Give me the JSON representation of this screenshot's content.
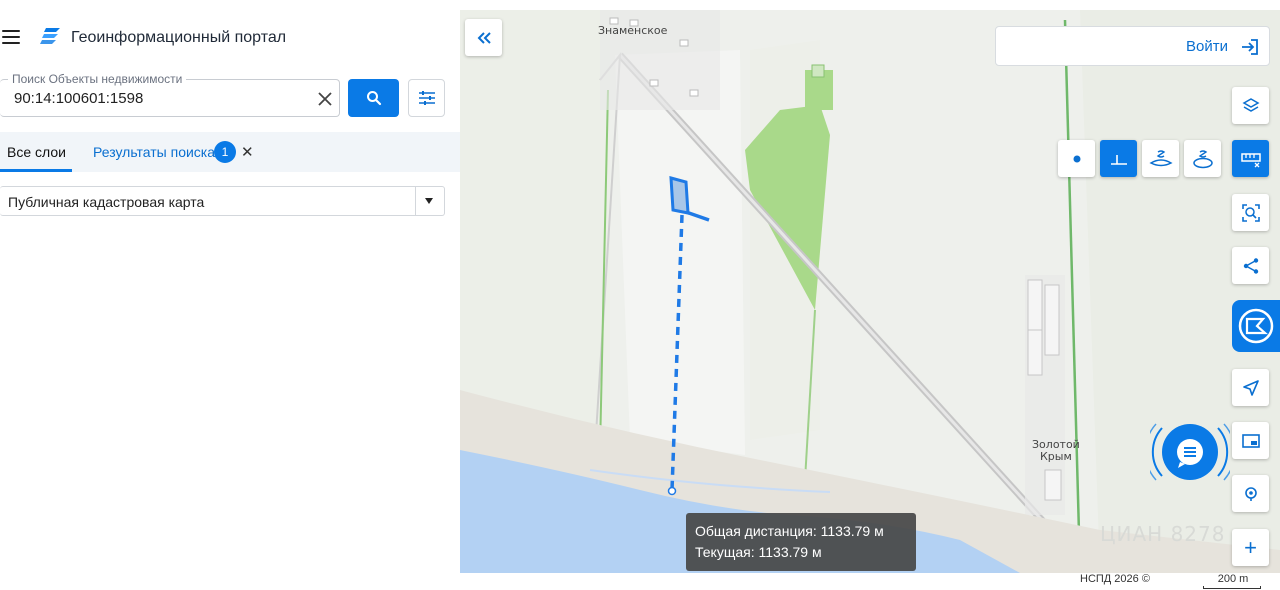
{
  "header": {
    "title": "Геоинформационный портал"
  },
  "search": {
    "legend": "Поиск Объекты недвижимости",
    "value": "90:14:100601:1598"
  },
  "tabs": {
    "all_label": "Все слои",
    "results_label": "Результаты поиска",
    "results_count": "1"
  },
  "layer_select": {
    "value": "Публичная кадастровая карта"
  },
  "login": {
    "label": "Войти"
  },
  "map": {
    "labels": {
      "village_top": "Знаменское",
      "village_right_1": "Золотой",
      "village_right_2": "Крым"
    },
    "watermark": "ЦИАН 8278"
  },
  "measurement": {
    "total_label": "Общая дистанция: 1133.79 м",
    "current_label": "Текущая: 1133.79 м"
  },
  "footer": {
    "copyright": "НСПД 2026 ©",
    "scale": "200 m"
  },
  "icons": {
    "menu": "hamburger-icon",
    "logo": "portal-logo-icon",
    "search": "search-icon",
    "filter": "filter-sliders-icon",
    "collapse": "double-chevron-left-icon",
    "login": "login-arrow-icon",
    "layers": "layers-icon",
    "point": "point-measure-icon",
    "line": "line-measure-icon",
    "area": "area-measure-icon",
    "area2": "area-measure-2-icon",
    "ruler": "ruler-icon",
    "select": "area-select-icon",
    "share": "share-icon",
    "kad": "cadastral-icon",
    "locate": "locate-arrow-icon",
    "minimap": "minimap-icon",
    "geo": "geo-pin-icon",
    "zoom_in": "plus-icon",
    "chat": "chat-icon"
  },
  "colors": {
    "accent": "#0a7ae6",
    "water": "#b3d1f3",
    "field": "#a9d98a",
    "road": "#c9c9c9"
  }
}
